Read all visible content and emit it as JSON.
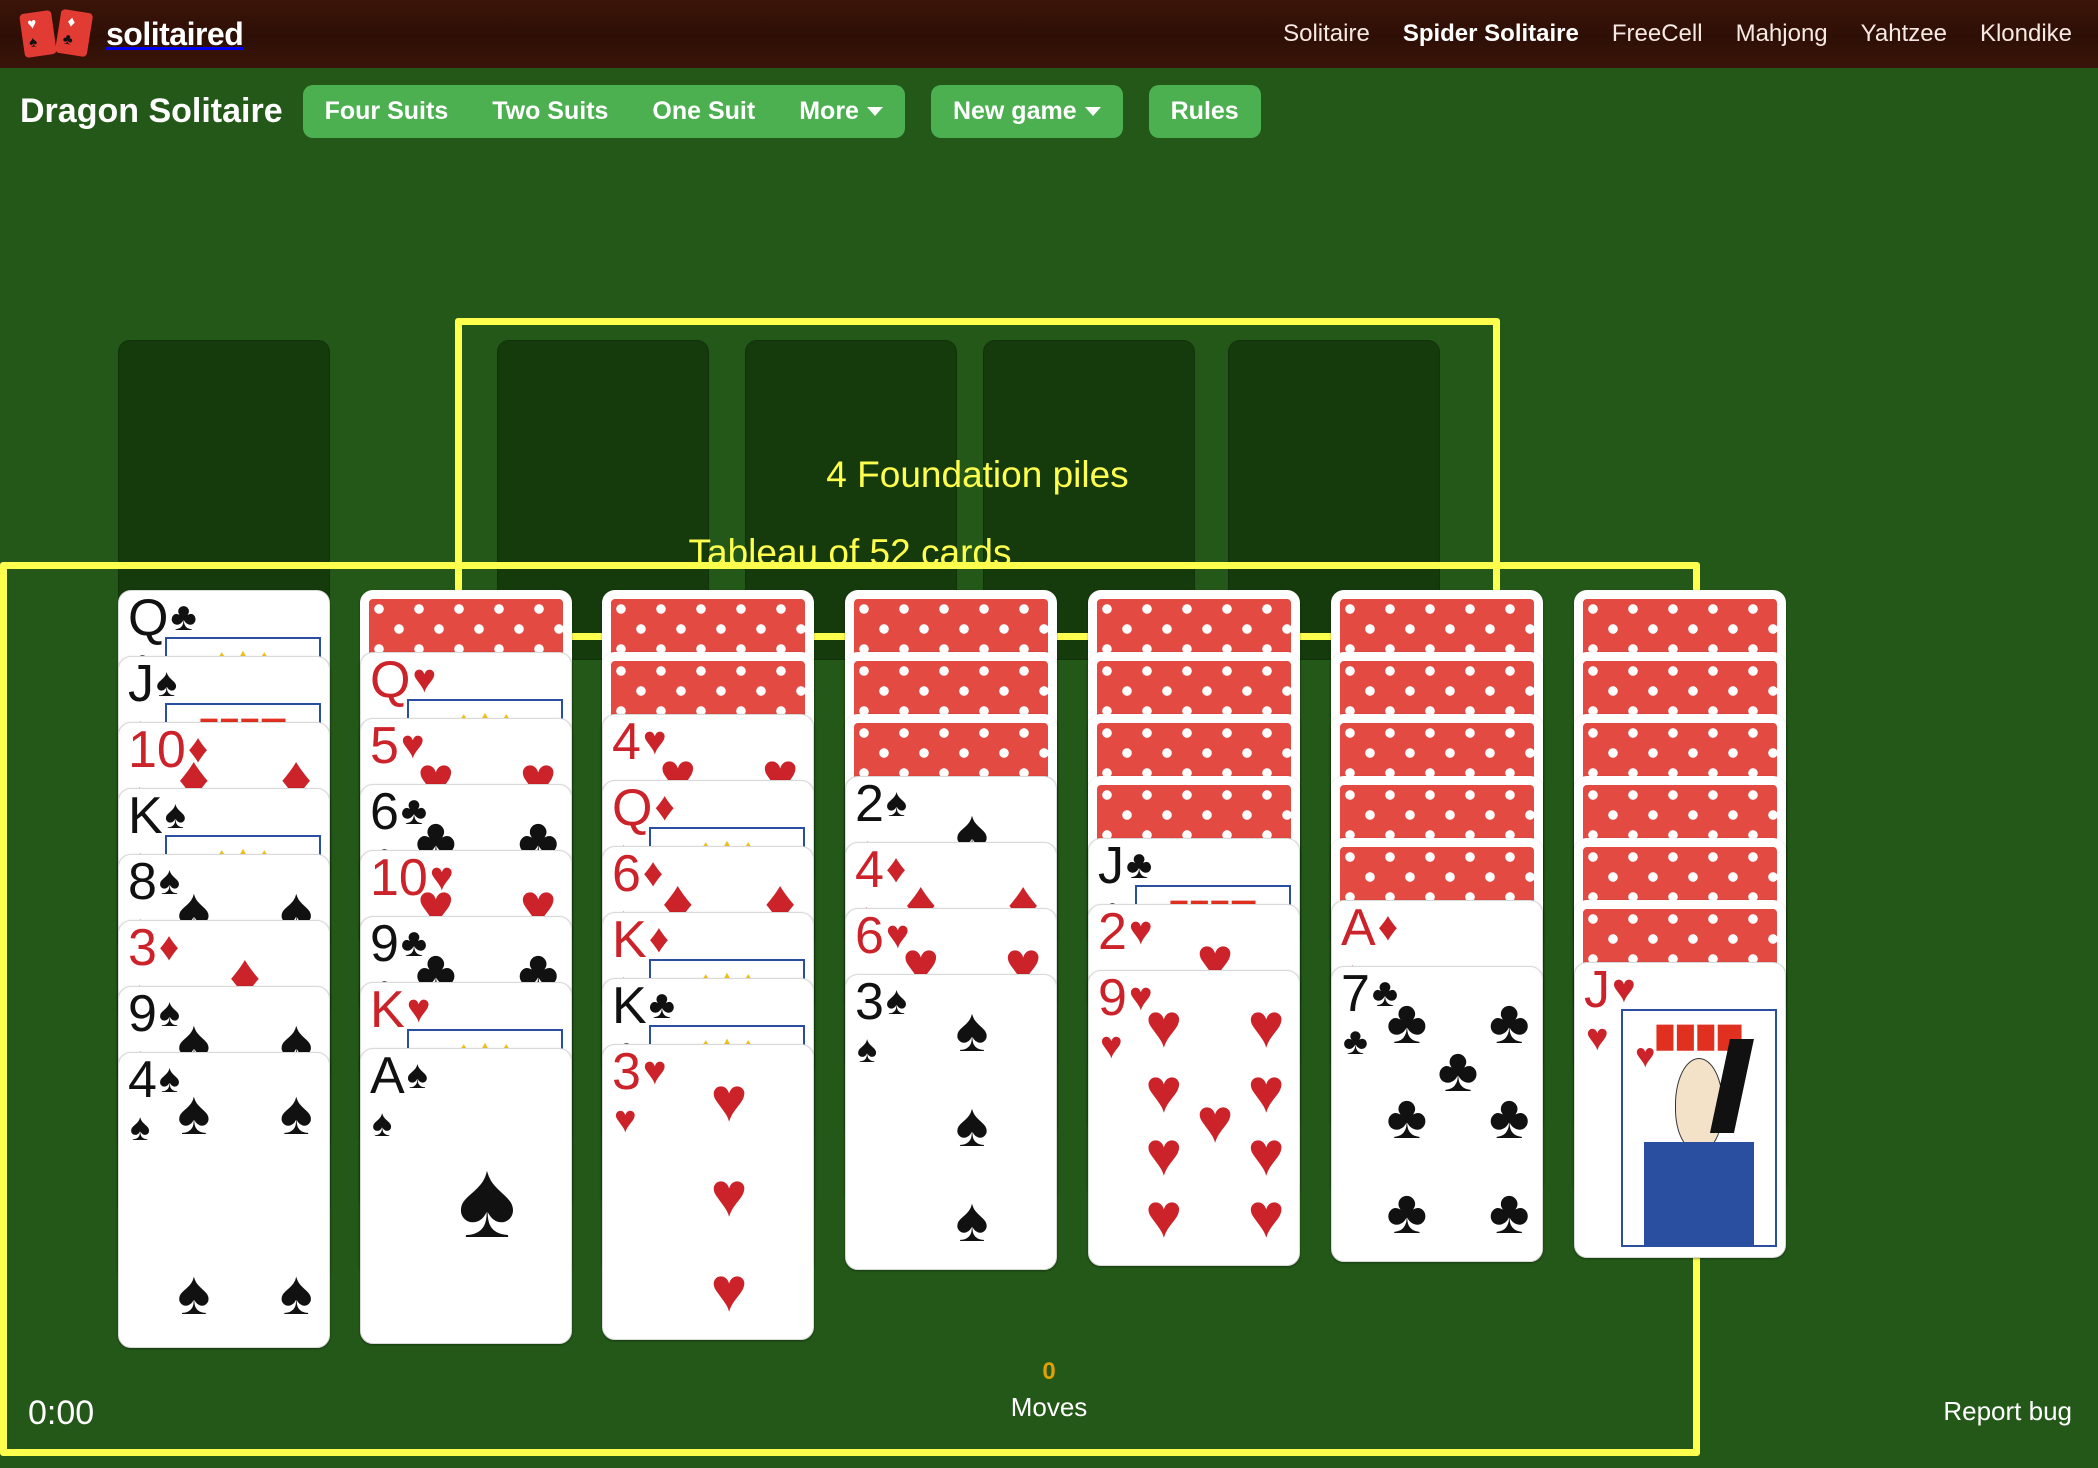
{
  "brand": {
    "name": "solitaired",
    "logo": "playing-cards-logo"
  },
  "nav": {
    "links": [
      {
        "label": "Solitaire",
        "active": false
      },
      {
        "label": "Spider Solitaire",
        "active": true
      },
      {
        "label": "FreeCell",
        "active": false
      },
      {
        "label": "Mahjong",
        "active": false
      },
      {
        "label": "Yahtzee",
        "active": false
      },
      {
        "label": "Klondike",
        "active": false
      }
    ]
  },
  "toolbar": {
    "game_title": "Dragon Solitaire",
    "suit_buttons": [
      "Four Suits",
      "Two Suits",
      "One Suit"
    ],
    "more_label": "More",
    "new_game_label": "New game",
    "rules_label": "Rules"
  },
  "annotations": {
    "foundation_label": "4 Foundation piles",
    "tableau_label": "Tableau of 52 cards",
    "highlight_color": "#ffff4d"
  },
  "board": {
    "stock_label": "stock-pile",
    "foundation_count": 4,
    "tableau": [
      {
        "facedown": 0,
        "faceup": [
          {
            "rank": "Q",
            "suit": "♣",
            "color": "black",
            "court": true
          },
          {
            "rank": "J",
            "suit": "♠",
            "color": "black",
            "court": true
          },
          {
            "rank": "10",
            "suit": "♦",
            "color": "red",
            "court": false
          },
          {
            "rank": "K",
            "suit": "♠",
            "color": "black",
            "court": true
          },
          {
            "rank": "8",
            "suit": "♠",
            "color": "black",
            "court": false
          },
          {
            "rank": "3",
            "suit": "♦",
            "color": "red",
            "court": false
          },
          {
            "rank": "9",
            "suit": "♠",
            "color": "black",
            "court": false
          },
          {
            "rank": "4",
            "suit": "♠",
            "color": "black",
            "court": false
          }
        ]
      },
      {
        "facedown": 1,
        "faceup": [
          {
            "rank": "Q",
            "suit": "♥",
            "color": "red",
            "court": true
          },
          {
            "rank": "5",
            "suit": "♥",
            "color": "red",
            "court": false
          },
          {
            "rank": "6",
            "suit": "♣",
            "color": "black",
            "court": false
          },
          {
            "rank": "10",
            "suit": "♥",
            "color": "red",
            "court": false
          },
          {
            "rank": "9",
            "suit": "♣",
            "color": "black",
            "court": false
          },
          {
            "rank": "K",
            "suit": "♥",
            "color": "red",
            "court": true
          },
          {
            "rank": "A",
            "suit": "♠",
            "color": "black",
            "court": false
          }
        ]
      },
      {
        "facedown": 2,
        "faceup": [
          {
            "rank": "4",
            "suit": "♥",
            "color": "red",
            "court": false
          },
          {
            "rank": "Q",
            "suit": "♦",
            "color": "red",
            "court": true
          },
          {
            "rank": "6",
            "suit": "♦",
            "color": "red",
            "court": false
          },
          {
            "rank": "K",
            "suit": "♦",
            "color": "red",
            "court": true
          },
          {
            "rank": "K",
            "suit": "♣",
            "color": "black",
            "court": true
          },
          {
            "rank": "3",
            "suit": "♥",
            "color": "red",
            "court": false
          }
        ]
      },
      {
        "facedown": 3,
        "faceup": [
          {
            "rank": "2",
            "suit": "♠",
            "color": "black",
            "court": false
          },
          {
            "rank": "4",
            "suit": "♦",
            "color": "red",
            "court": false
          },
          {
            "rank": "6",
            "suit": "♥",
            "color": "red",
            "court": false
          },
          {
            "rank": "3",
            "suit": "♠",
            "color": "black",
            "court": false
          }
        ]
      },
      {
        "facedown": 4,
        "faceup": [
          {
            "rank": "J",
            "suit": "♣",
            "color": "black",
            "court": true
          },
          {
            "rank": "2",
            "suit": "♥",
            "color": "red",
            "court": false
          },
          {
            "rank": "9",
            "suit": "♥",
            "color": "red",
            "court": false
          }
        ]
      },
      {
        "facedown": 5,
        "faceup": [
          {
            "rank": "A",
            "suit": "♦",
            "color": "red",
            "court": false
          },
          {
            "rank": "7",
            "suit": "♣",
            "color": "black",
            "court": false
          }
        ]
      },
      {
        "facedown": 6,
        "faceup": [
          {
            "rank": "J",
            "suit": "♥",
            "color": "red",
            "court": true
          }
        ]
      }
    ]
  },
  "footer": {
    "timer": "0:00",
    "moves_value": "0",
    "moves_label": "Moves",
    "report_bug": "Report bug"
  }
}
